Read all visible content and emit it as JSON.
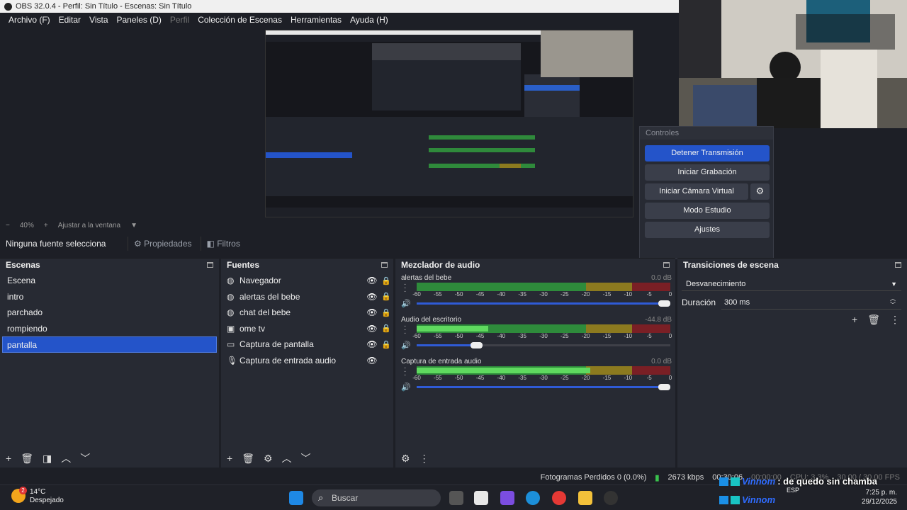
{
  "window": {
    "title": "OBS 32.0.4 - Perfil: Sin Título - Escenas: Sin Título"
  },
  "menubar": [
    {
      "label": "Archivo (F)",
      "enabled": true
    },
    {
      "label": "Editar",
      "enabled": true
    },
    {
      "label": "Vista",
      "enabled": true
    },
    {
      "label": "Paneles (D)",
      "enabled": true
    },
    {
      "label": "Perfil",
      "enabled": false
    },
    {
      "label": "Colección de Escenas",
      "enabled": true
    },
    {
      "label": "Herramientas",
      "enabled": true
    },
    {
      "label": "Ayuda (H)",
      "enabled": true
    }
  ],
  "zoom": {
    "minus": "−",
    "value": "40%",
    "plus": "+",
    "fit_label": "Ajustar a la ventana",
    "caret": "▼"
  },
  "controls": {
    "title": "Controles",
    "stop_stream": "Detener Transmisión",
    "start_recording": "Iniciar Grabación",
    "start_virtual_cam": "Iniciar Cámara Virtual",
    "studio_mode": "Modo Estudio",
    "settings": "Ajustes",
    "gear": "⚙"
  },
  "source_toolbar": {
    "no_source": "Ninguna fuente selecciona",
    "properties": "Propiedades",
    "filters": "Filtros",
    "properties_icon": "⚙",
    "filters_icon": "◧"
  },
  "scenes": {
    "title": "Escenas",
    "items": [
      "Escena",
      "intro",
      "parchado",
      "rompiendo",
      "pantalla"
    ],
    "selected_index": 4,
    "footer": {
      "add": "+",
      "remove": "🗑",
      "filter": "◨",
      "up": "︿",
      "down": "﹀"
    }
  },
  "sources": {
    "title": "Fuentes",
    "items": [
      {
        "label": "Navegador",
        "icon": "globe-icon",
        "glyph": "◍"
      },
      {
        "label": "alertas del bebe",
        "icon": "globe-icon",
        "glyph": "◍"
      },
      {
        "label": "chat del bebe",
        "icon": "globe-icon",
        "glyph": "◍"
      },
      {
        "label": "ome tv",
        "icon": "window-icon",
        "glyph": "▣"
      },
      {
        "label": "Captura de pantalla",
        "icon": "monitor-icon",
        "glyph": "▭"
      },
      {
        "label": "Captura de entrada audio",
        "icon": "microphone-icon",
        "glyph": "🎙"
      }
    ],
    "eye": "👁",
    "lock": "🔒",
    "footer": {
      "add": "+",
      "remove": "🗑",
      "settings": "⚙",
      "up": "︿",
      "down": "﹀"
    }
  },
  "mixer": {
    "title": "Mezclador de audio",
    "ticks": [
      "-60",
      "-55",
      "-50",
      "-45",
      "-40",
      "-35",
      "-30",
      "-25",
      "-20",
      "-15",
      "-10",
      "-5",
      "0"
    ],
    "channels": [
      {
        "name": "alertas del bebe",
        "db": "0.0 dB",
        "level_db": -60,
        "volume": 1.0
      },
      {
        "name": "Audio del escritorio",
        "db": "-44.8 dB",
        "level_db": -43,
        "volume": 0.26
      },
      {
        "name": "Captura de entrada audio",
        "db": "0.0 dB",
        "level_db": -19,
        "volume": 1.0
      }
    ],
    "footer": {
      "settings": "⚙",
      "more": "⋮"
    }
  },
  "transitions": {
    "title": "Transiciones de escena",
    "selected": "Desvanecimiento",
    "duration_label": "Duración",
    "duration_value": "300 ms",
    "add": "+",
    "remove": "🗑",
    "more": "⋮"
  },
  "status": {
    "dropped_frames": "Fotogramas Perdidos 0 (0.0%)",
    "bitrate": "2673 kbps",
    "stream_time": "00:30:06",
    "record_time": "00:00:00",
    "cpu": "CPU: 3.3%",
    "fps": "30.00 / 30.00 FPS"
  },
  "taskbar": {
    "weather_temp": "14°C",
    "weather_desc": "Despejado",
    "weather_badge": "2",
    "search_placeholder": "Buscar",
    "search_icon": "⌕",
    "lang": "ESP",
    "time": "7:25 p. m.",
    "date": "29/12/2025"
  },
  "chat": [
    {
      "user": "Vinnom",
      "message": ": de quedo sin chamba"
    },
    {
      "user": "Vinnom",
      "message": ""
    }
  ],
  "colors": {
    "accent": "#2454c9",
    "panel": "#272a33",
    "background": "#1d1f26",
    "meter_green": "#2e8b3b",
    "meter_yellow": "#8c7a1f",
    "meter_red": "#7a1f25"
  }
}
